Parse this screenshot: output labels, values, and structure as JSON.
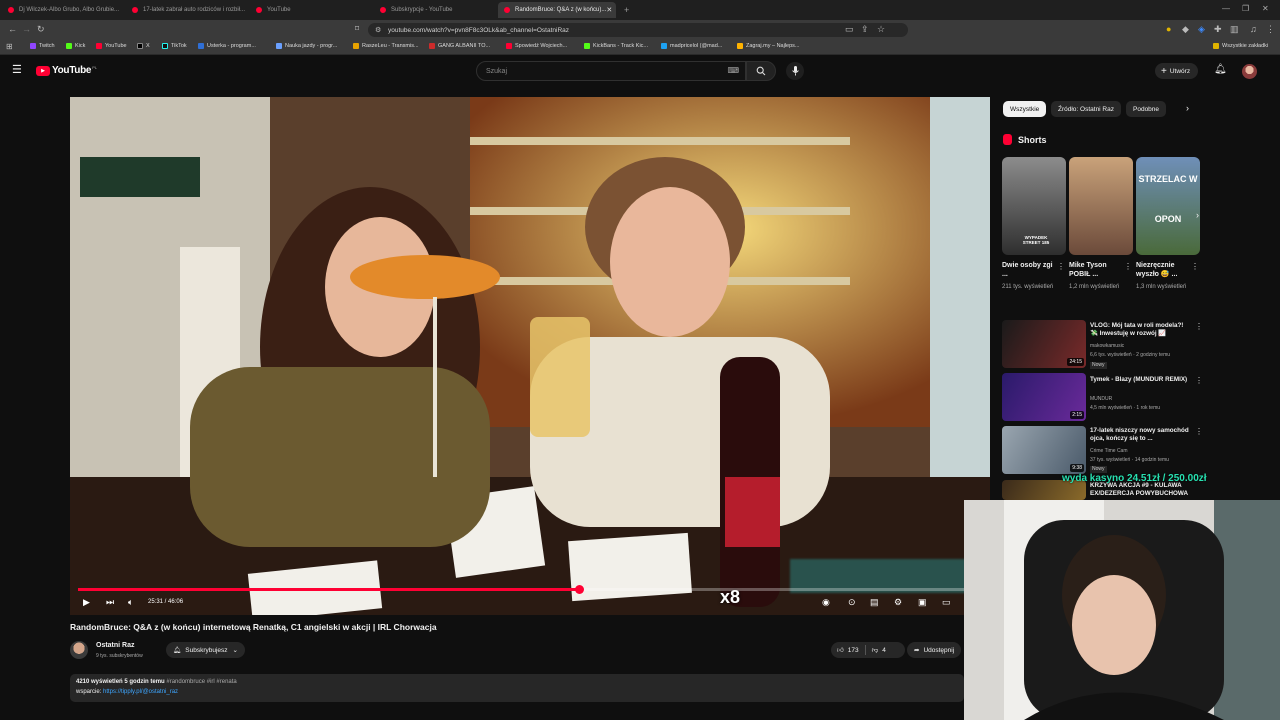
{
  "browser": {
    "tabs": [
      {
        "label": "Dj Wilczek-Albo Grubo, Albo Grubie..."
      },
      {
        "label": "17-latek zabrał auto rodziców i rozbił..."
      },
      {
        "label": "YouTube"
      },
      {
        "label": "Subskrypcje - YouTube"
      },
      {
        "label": "RandomBruce: Q&A z (w końcu)..."
      }
    ],
    "new_tab": "+",
    "address": "youtube.com/watch?v=pvn8F8c3OLk&ab_channel=OstatniRaz",
    "bookmarks": [
      "Twitch",
      "Kick",
      "YouTube",
      "X",
      "TikTok",
      "Usterka - program...",
      "Nauka jazdy - progr...",
      "RaszeLeu - Transmis...",
      "GANG ALBANII TO...",
      "Spowiedź Wojciech...",
      "KickBans - Track Kic...",
      "madpricelol (@mad...",
      "Zagraj.my – Najleps..."
    ],
    "bookmarks_all": "Wszystkie zakładki"
  },
  "youtube": {
    "logo": "YouTube",
    "logo_region": "PL",
    "search_placeholder": "Szukaj",
    "create_label": "Utwórz",
    "accent": "#ff0033"
  },
  "player": {
    "time": "25:31 / 46:06",
    "progress": 0.554,
    "overlay_multiplier": "x8"
  },
  "video": {
    "title": "RandomBruce: Q&A z (w końcu) internetową Renatką, C1 angielski w akcji | IRL Chorwacja",
    "channel": "Ostatni Raz",
    "subscribers": "9 tys. subskrybentów",
    "subscribed_label": "Subskrybujesz",
    "likes": "173",
    "dislikes": "4",
    "share_label": "Udostępnij",
    "views_line": "4210 wyświetleń  5 godzin temu",
    "hashtags": "#randombruce #irl #renata",
    "support_label": "wsparcie:",
    "support_link": "https://tipply.pl/@ostatni_raz"
  },
  "sidebar": {
    "chips": [
      "Wszystkie",
      "Źródło: Ostatni Raz",
      "Podobne"
    ],
    "shorts_label": "Shorts",
    "shorts": [
      {
        "title": "Dwie osoby zgi ...",
        "views": "211 tys. wyświetleń",
        "overlay": "WYPADEK STREET 185"
      },
      {
        "title": "Mike Tyson POBIŁ ...",
        "views": "1,2 mln wyświetleń",
        "overlay": ""
      },
      {
        "title": "Niezręcznie wyszło 😅 ...",
        "views": "1,3 mln wyświetleń",
        "overlay": "STRZELAC W OPON"
      }
    ],
    "videos": [
      {
        "title": "VLOG: Mój tata w roli modela?! 💸 Inwestuję w rozwój 📈",
        "channel": "makowkamusic",
        "meta": "6,6 tys. wyświetleń · 2 godziny temu",
        "badge": "Nowy",
        "duration": "24:15"
      },
      {
        "title": "Tymek - Blazy (MUNDUR REMIX)",
        "channel": "MUNDUR",
        "meta": "4,5 mln wyświetleń · 1 rok temu",
        "badge": "",
        "duration": "2:15"
      },
      {
        "title": "17-latek niszczy nowy samochód ojca, kończy się to ...",
        "channel": "Crime Time Cam",
        "meta": "37 tys. wyświetleń · 14 godzin temu",
        "badge": "Nowy",
        "duration": "9:38"
      },
      {
        "title": "KRZYWA AKCJA #9 - KULAWA EX/DEZERCJA POWYBUCHOWA",
        "channel": "",
        "meta": "",
        "badge": "",
        "duration": ""
      }
    ],
    "overlay_banner": "wyda kasyno 24.51zł / 250.00zł"
  }
}
